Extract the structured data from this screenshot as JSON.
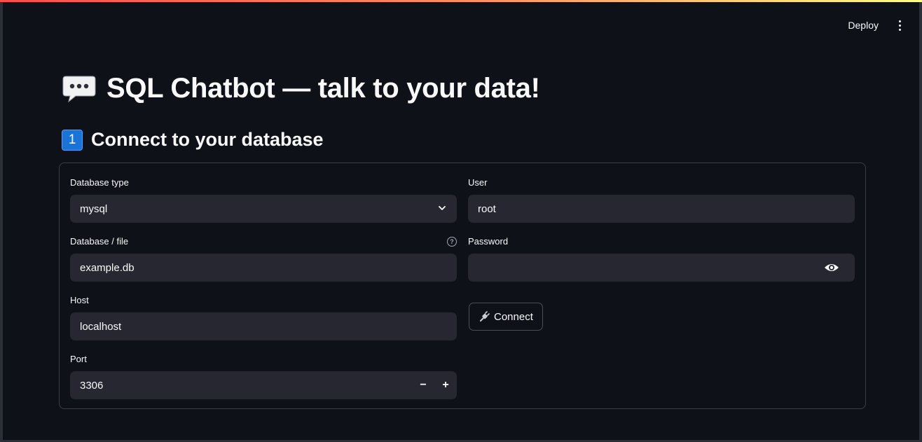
{
  "header": {
    "deploy_label": "Deploy",
    "menu_icon": "more-vertical-icon"
  },
  "page": {
    "title": "SQL Chatbot — talk to your data!",
    "title_icon": "speech-balloon-icon"
  },
  "section": {
    "number": "1",
    "title": "Connect to your database"
  },
  "form": {
    "db_type": {
      "label": "Database type",
      "value": "mysql"
    },
    "db_file": {
      "label": "Database / file",
      "value": "example.db",
      "help_icon": "?"
    },
    "host": {
      "label": "Host",
      "value": "localhost"
    },
    "port": {
      "label": "Port",
      "value": "3306",
      "minus": "−",
      "plus": "+"
    },
    "user": {
      "label": "User",
      "value": "root"
    },
    "password": {
      "label": "Password",
      "value": ""
    },
    "connect_label": "Connect"
  }
}
